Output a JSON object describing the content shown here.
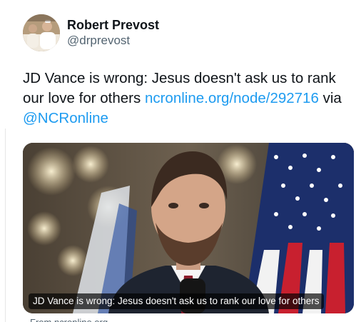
{
  "author": {
    "name": "Robert Prevost",
    "handle": "@drprevost"
  },
  "tweet": {
    "text": "JD Vance is wrong: Jesus doesn't ask us to rank our love for others",
    "link": "ncronline.org/node/292716",
    "via": "via",
    "mention": "@NCRonline"
  },
  "card": {
    "caption": "JD Vance is wrong: Jesus doesn't ask us to rank our love for others"
  },
  "footer": {
    "cut_text": "From ncronline.org"
  },
  "colors": {
    "link": "#1d9bf0",
    "handle": "#536471",
    "text": "#0f1419"
  }
}
